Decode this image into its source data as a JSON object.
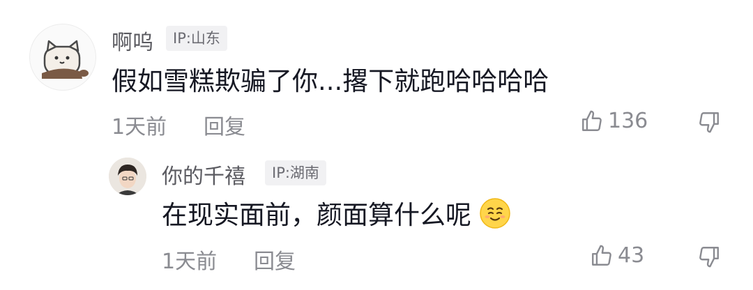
{
  "comment": {
    "username": "啊呜",
    "ip": "IP:山东",
    "text": "假如雪糕欺骗了你...撂下就跑哈哈哈哈",
    "time": "1天前",
    "reply_label": "回复",
    "likes": "136",
    "avatar_icon": "cat-avatar-icon"
  },
  "reply": {
    "username": "你的千禧",
    "ip": "IP:湖南",
    "text": "在现实面前，颜面算什么呢",
    "emoji_icon": "smirk-emoji-icon",
    "time": "1天前",
    "reply_label": "回复",
    "likes": "43"
  },
  "colors": {
    "username": "#5b5b61",
    "text": "#161823",
    "meta": "#8a8b91",
    "badge_bg": "#f1f1f3"
  }
}
